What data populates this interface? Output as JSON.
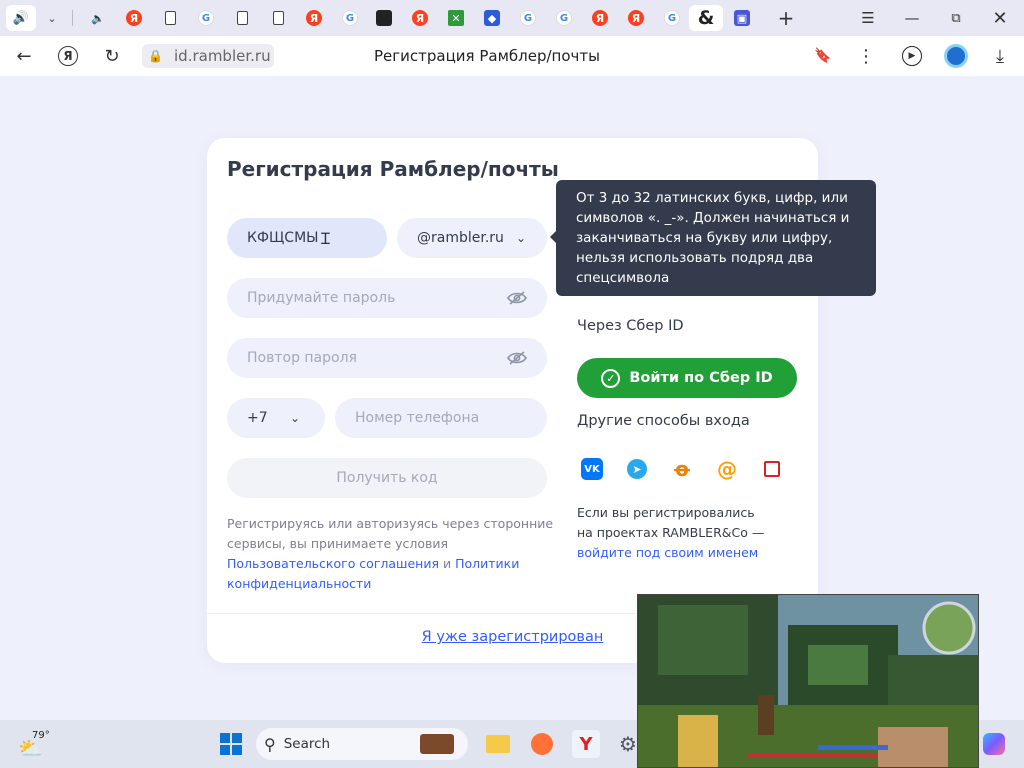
{
  "browser": {
    "address": "id.rambler.ru",
    "page_title": "Регистрация Рамблер/почты"
  },
  "form": {
    "title": "Регистрация Рамблер/почты",
    "login_value": "КФЩСМЫ",
    "domain_value": "@rambler.ru",
    "password_placeholder": "Придумайте пароль",
    "repeat_password_placeholder": "Повтор пароля",
    "phone_code": "+7",
    "phone_placeholder": "Номер телефона",
    "get_code_label": "Получить код",
    "terms_text": "Регистрируясь или авторизуясь через сторонние сервисы, вы принимаете условия",
    "terms_link1": "Пользовательского соглашения",
    "terms_and": "и",
    "terms_link2": "Политики конфиденциальности",
    "already_registered": "Я уже зарегистрирован"
  },
  "tooltip": {
    "text": "От 3 до 32 латинских букв, цифр, или символов «. _-». Должен начинаться и заканчиваться на букву или цифру, нельзя использовать подряд два спецсимвола"
  },
  "sidebar": {
    "sber_label": "Через Сбер ID",
    "sber_button": "Войти по Сбер ID",
    "other_label": "Другие способы входа",
    "existing_text_line1": "Если вы регистрировались",
    "existing_text_line2": "на проектах RAMBLER&Co —",
    "existing_link": "войдите под своим именем"
  },
  "taskbar": {
    "temperature": "79°",
    "search_placeholder": "Search"
  },
  "colors": {
    "accent_blue": "#315efb",
    "sber_green": "#21a038",
    "tooltip_bg": "#343b4c",
    "page_bg": "#eef0fb"
  }
}
